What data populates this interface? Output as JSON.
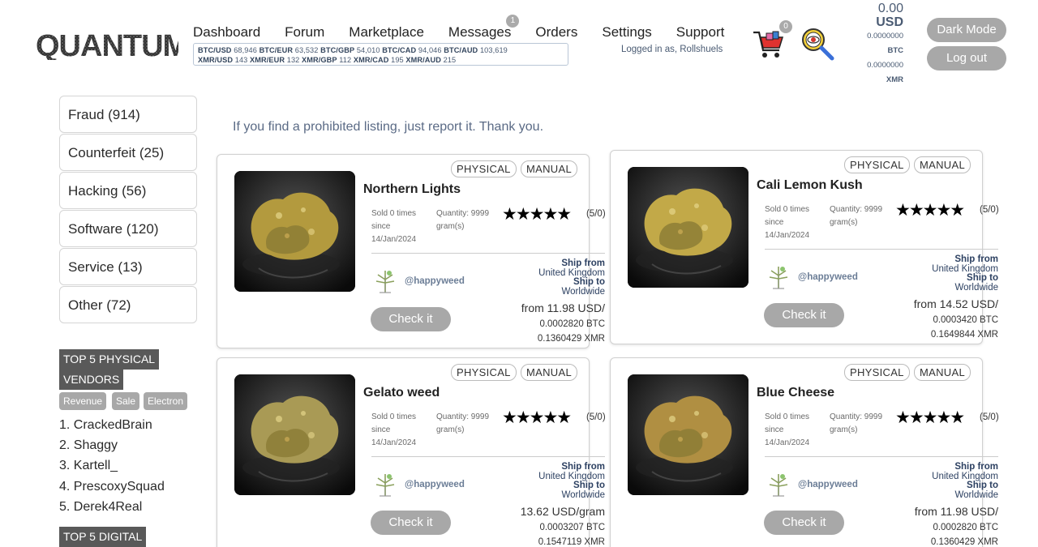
{
  "header": {
    "logo_text": "QUANTUM",
    "nav": [
      {
        "label": "Dashboard"
      },
      {
        "label": "Forum"
      },
      {
        "label": "Marketplace"
      },
      {
        "label": "Messages",
        "badge": "1"
      },
      {
        "label": "Orders"
      },
      {
        "label": "Settings"
      },
      {
        "label": "Support"
      }
    ],
    "ticker_line1": [
      {
        "pair": "BTC/USD",
        "value": "68,946"
      },
      {
        "pair": "BTC/EUR",
        "value": "63,532"
      },
      {
        "pair": "BTC/GBP",
        "value": "54,010"
      },
      {
        "pair": "BTC/CAD",
        "value": "94,046"
      },
      {
        "pair": "BTC/AUD",
        "value": "103,619"
      }
    ],
    "ticker_line2": [
      {
        "pair": "XMR/USD",
        "value": "143"
      },
      {
        "pair": "XMR/EUR",
        "value": "132"
      },
      {
        "pair": "XMR/GBP",
        "value": "112"
      },
      {
        "pair": "XMR/CAD",
        "value": "195"
      },
      {
        "pair": "XMR/AUD",
        "value": "215"
      }
    ],
    "logged_in": "Logged in as, Rollshuels",
    "cart_count": "0",
    "balance": {
      "usd_value": "0.00",
      "usd_label": "USD",
      "btc_value": "0.0000000",
      "btc_label": "BTC",
      "xmr_value": "0.0000000",
      "xmr_label": "XMR"
    },
    "dark_mode": "Dark Mode",
    "logout": "Log out"
  },
  "sidebar": {
    "categories": [
      {
        "label": "Fraud (914)"
      },
      {
        "label": "Counterfeit (25)"
      },
      {
        "label": "Hacking (56)"
      },
      {
        "label": "Software (120)"
      },
      {
        "label": "Service (13)"
      },
      {
        "label": "Other (72)"
      }
    ],
    "physical_title_1": "TOP 5 PHYSICAL",
    "physical_title_2": "VENDORS",
    "tags": [
      "Revenue",
      "Sale",
      "Electron"
    ],
    "vendors": [
      "1. CrackedBrain",
      "2. Shaggy",
      "3. Kartell_",
      "4. PrescoxySquad",
      "5. Derek4Real"
    ],
    "digital_title": "TOP 5 DIGITAL"
  },
  "notice": "If you find a prohibited listing, just report it. Thank you.",
  "listings": [
    {
      "badge1": "PHYSICAL",
      "badge2": "MANUAL",
      "title": "Northern Lights",
      "sold1": "Sold 0 times",
      "sold2": "since",
      "sold3": "14/Jan/2024",
      "qty1": "Quantity: 9999",
      "qty2": "gram(s)",
      "stars": "★★★★★",
      "score": "(5/0)",
      "vendor": "@happyweed",
      "ship_from_label": "Ship from",
      "ship_from": "United Kingdom",
      "ship_to_label": "Ship to",
      "ship_to": "Worldwide",
      "check": "Check it",
      "price": "from 11.98 USD/",
      "btc": "0.0002820 BTC",
      "xmr": "0.1360429 XMR",
      "photo_tint": "#b39a3e"
    },
    {
      "badge1": "PHYSICAL",
      "badge2": "MANUAL",
      "title": "Cali Lemon Kush",
      "sold1": "Sold 0 times",
      "sold2": "since",
      "sold3": "14/Jan/2024",
      "qty1": "Quantity: 9999",
      "qty2": "gram(s)",
      "stars": "★★★★★",
      "score": "(5/0)",
      "vendor": "@happyweed",
      "ship_from_label": "Ship from",
      "ship_from": "United Kingdom",
      "ship_to_label": "Ship to",
      "ship_to": "Worldwide",
      "check": "Check it",
      "price": "from 14.52 USD/",
      "btc": "0.0003420 BTC",
      "xmr": "0.1649844 XMR",
      "photo_tint": "#c2a948"
    },
    {
      "badge1": "PHYSICAL",
      "badge2": "MANUAL",
      "title": "Gelato weed",
      "sold1": "Sold 0 times",
      "sold2": "since",
      "sold3": "14/Jan/2024",
      "qty1": "Quantity: 9999",
      "qty2": "gram(s)",
      "stars": "★★★★★",
      "score": "(5/0)",
      "vendor": "@happyweed",
      "ship_from_label": "Ship from",
      "ship_from": "United Kingdom",
      "ship_to_label": "Ship to",
      "ship_to": "Worldwide",
      "check": "Check it",
      "price": "13.62 USD/gram",
      "btc": "0.0003207 BTC",
      "xmr": "0.1547119 XMR",
      "photo_tint": "#a99a55"
    },
    {
      "badge1": "PHYSICAL",
      "badge2": "MANUAL",
      "title": "Blue Cheese",
      "sold1": "Sold 0 times",
      "sold2": "since",
      "sold3": "14/Jan/2024",
      "qty1": "Quantity: 9999",
      "qty2": "gram(s)",
      "stars": "★★★★★",
      "score": "(5/0)",
      "vendor": "@happyweed",
      "ship_from_label": "Ship from",
      "ship_from": "United Kingdom",
      "ship_to_label": "Ship to",
      "ship_to": "Worldwide",
      "check": "Check it",
      "price": "from 11.98 USD/",
      "btc": "0.0002820 BTC",
      "xmr": "0.1360429 XMR",
      "photo_tint": "#b08f42"
    }
  ]
}
